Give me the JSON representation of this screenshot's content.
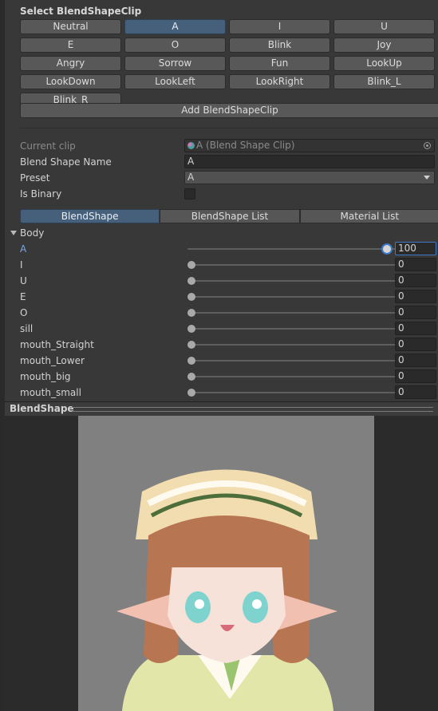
{
  "section_title": "Select BlendShapeClip",
  "clip_buttons": [
    "Neutral",
    "A",
    "I",
    "U",
    "E",
    "O",
    "Blink",
    "Joy",
    "Angry",
    "Sorrow",
    "Fun",
    "LookUp",
    "LookDown",
    "LookLeft",
    "LookRight",
    "Blink_L",
    "Blink_R"
  ],
  "selected_clip": "A",
  "add_button_label": "Add BlendShapeClip",
  "properties": {
    "current_clip_label": "Current clip",
    "current_clip_value": "A (Blend Shape Clip)",
    "blend_shape_name_label": "Blend Shape Name",
    "blend_shape_name_value": "A",
    "preset_label": "Preset",
    "preset_value": "A",
    "is_binary_label": "Is Binary",
    "is_binary_checked": false
  },
  "tabs": [
    "BlendShape",
    "BlendShape List",
    "Material List"
  ],
  "active_tab": "BlendShape",
  "mesh_group": "Body",
  "blendshapes": [
    {
      "name": "A",
      "value": "100",
      "level": 1.0
    },
    {
      "name": "I",
      "value": "0",
      "level": 0
    },
    {
      "name": "U",
      "value": "0",
      "level": 0
    },
    {
      "name": "E",
      "value": "0",
      "level": 0
    },
    {
      "name": "O",
      "value": "0",
      "level": 0
    },
    {
      "name": "sill",
      "value": "0",
      "level": 0
    },
    {
      "name": "mouth_Straight",
      "value": "0",
      "level": 0
    },
    {
      "name": "mouth_Lower",
      "value": "0",
      "level": 0
    },
    {
      "name": "mouth_big",
      "value": "0",
      "level": 0
    },
    {
      "name": "mouth_small",
      "value": "0",
      "level": 0
    }
  ],
  "preview_title": "BlendShape",
  "colors": {
    "background": "#383838",
    "selected_accent": "#46607c",
    "focus_blue": "#3c78c8",
    "viewport_gray": "#808080"
  }
}
